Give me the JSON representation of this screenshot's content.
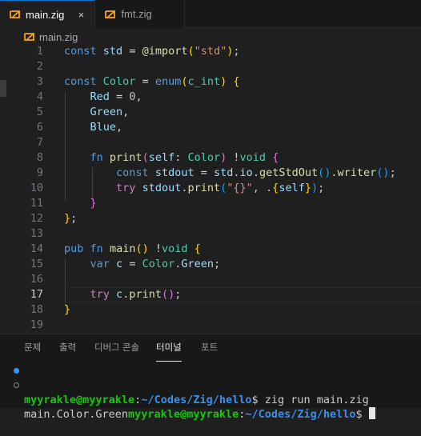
{
  "tabs": [
    {
      "label": "main.zig",
      "active": true,
      "icon": "zig-icon"
    },
    {
      "label": "fmt.zig",
      "active": false,
      "icon": "zig-icon"
    }
  ],
  "tab_close_glyph": "×",
  "breadcrumb": {
    "file": "main.zig",
    "icon": "zig-icon"
  },
  "editor": {
    "current_line": 17,
    "line_numbers": [
      "1",
      "2",
      "3",
      "4",
      "5",
      "6",
      "7",
      "8",
      "9",
      "10",
      "11",
      "12",
      "13",
      "14",
      "15",
      "16",
      "17",
      "18",
      "19"
    ]
  },
  "panel": {
    "tabs": [
      "문제",
      "출력",
      "디버그 콘솔",
      "터미널",
      "포트"
    ],
    "active_tab": "터미널",
    "terminal": {
      "line1": {
        "user_host": "myyrakle@myyrakle",
        "sep": ":",
        "path": "~/Codes/Zig/hello",
        "prompt": "$ ",
        "command": "zig run main.zig"
      },
      "line2": {
        "output": "main.Color.Green",
        "user_host": "myyrakle@myyrakle",
        "sep": ":",
        "path": "~/Codes/Zig/hello",
        "prompt": "$ "
      }
    }
  },
  "colors": {
    "accent": "#0078d4",
    "zig_orange": "#f7a41d",
    "terminal_green": "#16c60c",
    "terminal_blue": "#3b8eea"
  }
}
